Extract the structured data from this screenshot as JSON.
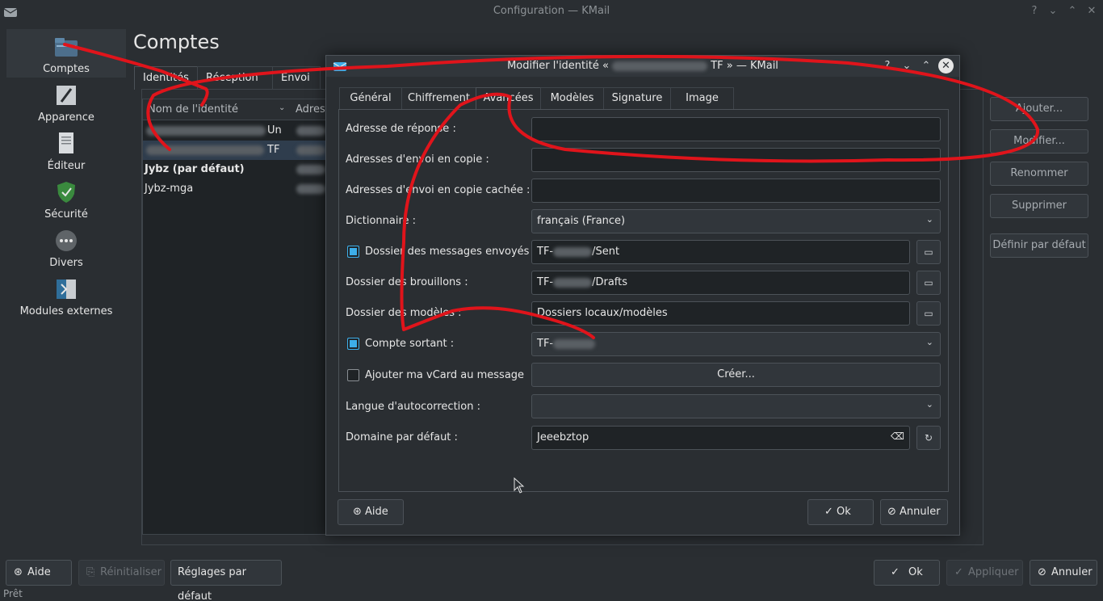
{
  "window": {
    "title": "Configuration — KMail",
    "help": "?",
    "minimize": "⌄",
    "maximize": "⌃",
    "close": "✕"
  },
  "sidebar": {
    "items": [
      {
        "label": "Comptes",
        "icon": "folder-icon"
      },
      {
        "label": "Apparence",
        "icon": "brush-icon"
      },
      {
        "label": "Éditeur",
        "icon": "document-icon"
      },
      {
        "label": "Sécurité",
        "icon": "shield-icon"
      },
      {
        "label": "Divers",
        "icon": "dots-icon"
      },
      {
        "label": "Modules externes",
        "icon": "plugin-icon"
      }
    ]
  },
  "page": {
    "title": "Comptes",
    "tabs": [
      "Identités",
      "Réception",
      "Envoi"
    ]
  },
  "identity_list": {
    "header_name": "Nom de l'identité",
    "header_address": "Adress",
    "rows": [
      {
        "suffix": "Un"
      },
      {
        "suffix": "TF"
      },
      {
        "name": "Jybz (par défaut)"
      },
      {
        "name": "Jybz-mga"
      }
    ]
  },
  "side_buttons": {
    "add": "Ajouter...",
    "modify": "Modifier...",
    "rename": "Renommer",
    "delete": "Supprimer",
    "set_default": "Définir par défaut"
  },
  "bottom": {
    "help": "Aide",
    "reset": "Réinitialiser",
    "defaults": "Réglages par défaut",
    "ok": "Ok",
    "apply": "Appliquer",
    "cancel": "Annuler",
    "status": "Prêt"
  },
  "dialog": {
    "title_prefix": "Modifier l'identité «",
    "title_suffix": "TF » — KMail",
    "help": "?",
    "minimize": "⌄",
    "maximize": "⌃",
    "close": "✕",
    "tabs": [
      "Général",
      "Chiffrement",
      "Avancées",
      "Modèles",
      "Signature",
      "Image"
    ],
    "fields": {
      "reply_to_label": "Adresse de réponse :",
      "reply_to_value": "",
      "cc_label": "Adresses d'envoi en copie :",
      "cc_value": "",
      "bcc_label": "Adresses d'envoi en copie cachée :",
      "bcc_value": "",
      "dictionary_label": "Dictionnaire :",
      "dictionary_value": "français (France)",
      "sent_label": "Dossier des messages envoyés :",
      "sent_prefix": "TF-",
      "sent_suffix": "/Sent",
      "drafts_label": "Dossier des brouillons :",
      "drafts_prefix": "TF-",
      "drafts_suffix": "/Drafts",
      "templates_label": "Dossier des modèles :",
      "templates_value": "Dossiers locaux/modèles",
      "outgoing_label": "Compte sortant :",
      "outgoing_prefix": "TF-",
      "vcard_label": "Ajouter ma vCard au message",
      "vcard_button": "Créer...",
      "autocorrect_label": "Langue d'autocorrection :",
      "autocorrect_value": "",
      "domain_label": "Domaine par défaut :",
      "domain_value": "Jeeebztop"
    },
    "buttons": {
      "help": "Aide",
      "ok": "Ok",
      "cancel": "Annuler"
    }
  },
  "colors": {
    "background": "#2a2e32",
    "accent": "#3daee9",
    "annotation": "#e0141b"
  }
}
